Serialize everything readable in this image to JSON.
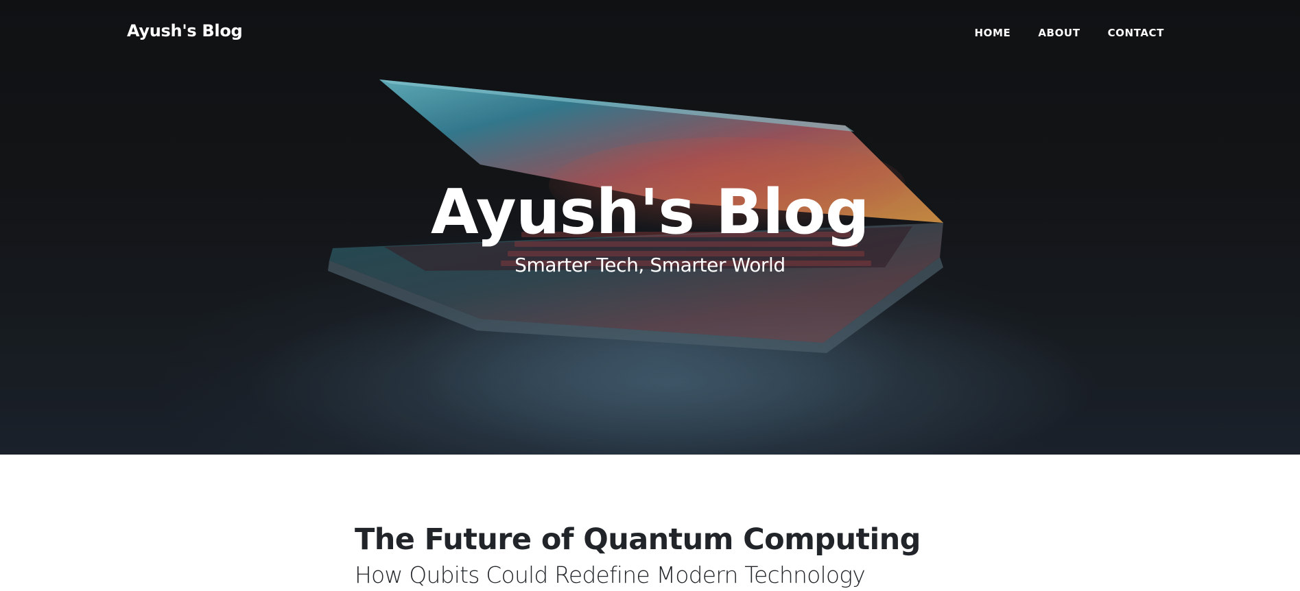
{
  "navbar": {
    "brand": "Ayush's Blog",
    "links": [
      "HOME",
      "ABOUT",
      "CONTACT"
    ]
  },
  "hero": {
    "title": "Ayush's Blog",
    "subtitle": "Smarter Tech, Smarter World",
    "image": "laptop-photo"
  },
  "posts": [
    {
      "title": "The Future of Quantum Computing",
      "subtitle": "How Qubits Could Redefine Modern Technology"
    }
  ],
  "colors": {
    "hero_background": "#141518",
    "text_light": "#ffffff",
    "text_dark": "#212529",
    "page_background": "#ffffff"
  }
}
